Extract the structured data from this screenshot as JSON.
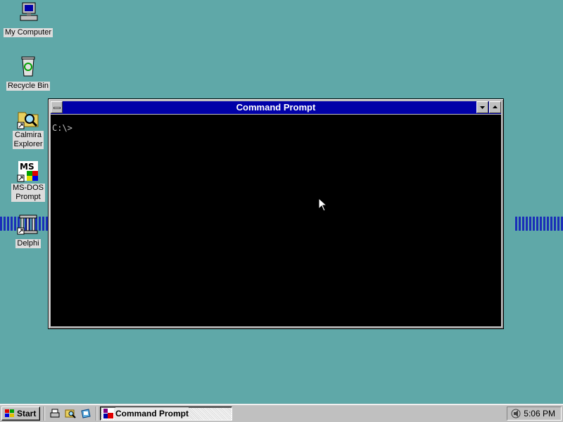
{
  "desktop": {
    "icons": [
      {
        "label": "My Computer"
      },
      {
        "label": "Recycle Bin"
      },
      {
        "label_line1": "Calmira",
        "label_line2": "Explorer"
      },
      {
        "label_line1": "MS-DOS",
        "label_line2": "Prompt"
      },
      {
        "label": "Delphi"
      }
    ]
  },
  "window": {
    "title": "Command Prompt",
    "prompt": "C:\\>"
  },
  "taskbar": {
    "start_label": "Start",
    "task_label": "Command Prompt",
    "clock": "5:06 PM"
  },
  "colors": {
    "desktop": "#5fa8a8",
    "titlebar": "#0000a8",
    "console": "#000000"
  }
}
